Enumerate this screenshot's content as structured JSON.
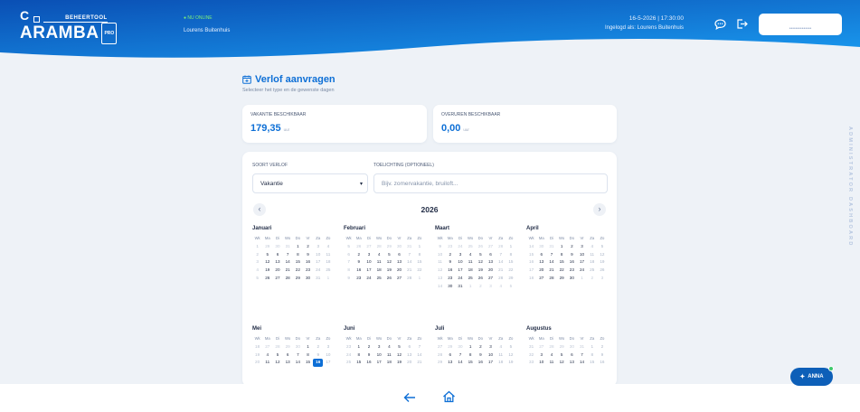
{
  "colors": {
    "brand": "#0d6fd6",
    "header_top": "#0a4fb4",
    "header_bottom": "#1a9bf0",
    "online": "#7cf07a",
    "today": "#0d6fd6"
  },
  "header": {
    "logo_top": "C",
    "logo_sub": "BEHEERTOOL",
    "logo_main": "ARAMBA",
    "logo_pro": "PRO",
    "status": "● NU ONLINE",
    "user": "Lourens Buitenhuis",
    "datetime": "16-5-2026 | 17:30:00",
    "logged_in": "Ingelogd als: Lourens Buitenhuis",
    "chat_icon": "chat-bubble-icon",
    "logout_icon": "logout-icon",
    "button_label": "••••••••••••••"
  },
  "page": {
    "title": "Verlof aanvragen",
    "subtitle": "Selecteer het type en de gewenste dagen"
  },
  "cards": [
    {
      "label": "VAKANTIE BESCHIKBAAR",
      "value": "179,35",
      "unit": "uur"
    },
    {
      "label": "OVERUREN BESCHIKBAAR",
      "value": "0,00",
      "unit": "uur"
    }
  ],
  "form": {
    "type_label": "SOORT VERLOF",
    "type_value": "Vakantie",
    "note_label": "TOELICHTING (OPTIONEEL)",
    "note_placeholder": "Bijv. zomervakantie, bruiloft..."
  },
  "calendar": {
    "year": "2026",
    "prev": "‹",
    "next": "›",
    "weekday_headers": [
      "Wk",
      "Ma",
      "Di",
      "Wo",
      "Do",
      "Vr",
      "Za",
      "Zo"
    ],
    "today": {
      "month": "Mei",
      "day": "16"
    },
    "months": [
      {
        "name": "Januari",
        "weeks": [
          {
            "wk": "1",
            "days": [
              "29",
              "30",
              "31",
              "1",
              "2",
              "3",
              "4"
            ]
          },
          {
            "wk": "2",
            "days": [
              "5",
              "6",
              "7",
              "8",
              "9",
              "10",
              "11"
            ]
          },
          {
            "wk": "3",
            "days": [
              "12",
              "13",
              "14",
              "15",
              "16",
              "17",
              "18"
            ]
          },
          {
            "wk": "4",
            "days": [
              "19",
              "20",
              "21",
              "22",
              "23",
              "24",
              "25"
            ]
          },
          {
            "wk": "5",
            "days": [
              "26",
              "27",
              "28",
              "29",
              "30",
              "31",
              "1"
            ]
          }
        ]
      },
      {
        "name": "Februari",
        "weeks": [
          {
            "wk": "5",
            "days": [
              "26",
              "27",
              "28",
              "29",
              "30",
              "31",
              "1"
            ]
          },
          {
            "wk": "6",
            "days": [
              "2",
              "3",
              "4",
              "5",
              "6",
              "7",
              "8"
            ]
          },
          {
            "wk": "7",
            "days": [
              "9",
              "10",
              "11",
              "12",
              "13",
              "14",
              "15"
            ]
          },
          {
            "wk": "8",
            "days": [
              "16",
              "17",
              "18",
              "19",
              "20",
              "21",
              "22"
            ]
          },
          {
            "wk": "9",
            "days": [
              "23",
              "24",
              "25",
              "26",
              "27",
              "28",
              "1"
            ]
          }
        ]
      },
      {
        "name": "Maart",
        "weeks": [
          {
            "wk": "9",
            "days": [
              "23",
              "24",
              "25",
              "26",
              "27",
              "28",
              "1"
            ]
          },
          {
            "wk": "10",
            "days": [
              "2",
              "3",
              "4",
              "5",
              "6",
              "7",
              "8"
            ]
          },
          {
            "wk": "11",
            "days": [
              "9",
              "10",
              "11",
              "12",
              "13",
              "14",
              "15"
            ]
          },
          {
            "wk": "12",
            "days": [
              "16",
              "17",
              "18",
              "19",
              "20",
              "21",
              "22"
            ]
          },
          {
            "wk": "13",
            "days": [
              "23",
              "24",
              "25",
              "26",
              "27",
              "28",
              "29"
            ]
          },
          {
            "wk": "14",
            "days": [
              "30",
              "31",
              "1",
              "2",
              "3",
              "4",
              "5"
            ]
          }
        ]
      },
      {
        "name": "April",
        "weeks": [
          {
            "wk": "14",
            "days": [
              "30",
              "31",
              "1",
              "2",
              "3",
              "4",
              "5"
            ]
          },
          {
            "wk": "15",
            "days": [
              "6",
              "7",
              "8",
              "9",
              "10",
              "11",
              "12"
            ]
          },
          {
            "wk": "16",
            "days": [
              "13",
              "14",
              "15",
              "16",
              "17",
              "18",
              "19"
            ]
          },
          {
            "wk": "17",
            "days": [
              "20",
              "21",
              "22",
              "23",
              "24",
              "25",
              "26"
            ]
          },
          {
            "wk": "18",
            "days": [
              "27",
              "28",
              "29",
              "30",
              "1",
              "2",
              "3"
            ]
          }
        ]
      },
      {
        "name": "Mei",
        "weeks": [
          {
            "wk": "18",
            "days": [
              "27",
              "28",
              "29",
              "30",
              "1",
              "2",
              "3"
            ]
          },
          {
            "wk": "19",
            "days": [
              "4",
              "5",
              "6",
              "7",
              "8",
              "9",
              "10"
            ]
          },
          {
            "wk": "20",
            "days": [
              "11",
              "12",
              "13",
              "14",
              "15",
              "16",
              "17"
            ]
          }
        ]
      },
      {
        "name": "Juni",
        "weeks": [
          {
            "wk": "23",
            "days": [
              "1",
              "2",
              "3",
              "4",
              "5",
              "6",
              "7"
            ]
          },
          {
            "wk": "24",
            "days": [
              "8",
              "9",
              "10",
              "11",
              "12",
              "13",
              "14"
            ]
          },
          {
            "wk": "25",
            "days": [
              "15",
              "16",
              "17",
              "18",
              "19",
              "20",
              "21"
            ]
          }
        ]
      },
      {
        "name": "Juli",
        "weeks": [
          {
            "wk": "27",
            "days": [
              "29",
              "30",
              "1",
              "2",
              "3",
              "4",
              "5"
            ]
          },
          {
            "wk": "28",
            "days": [
              "6",
              "7",
              "8",
              "9",
              "10",
              "11",
              "12"
            ]
          },
          {
            "wk": "29",
            "days": [
              "13",
              "14",
              "15",
              "16",
              "17",
              "18",
              "19"
            ]
          }
        ]
      },
      {
        "name": "Augustus",
        "weeks": [
          {
            "wk": "31",
            "days": [
              "27",
              "28",
              "29",
              "30",
              "31",
              "1",
              "2"
            ]
          },
          {
            "wk": "32",
            "days": [
              "3",
              "4",
              "5",
              "6",
              "7",
              "8",
              "9"
            ]
          },
          {
            "wk": "33",
            "days": [
              "10",
              "11",
              "12",
              "13",
              "14",
              "15",
              "16"
            ]
          }
        ]
      }
    ]
  },
  "sidebar_label": "ADMINISTRATOR DASHBOARD",
  "assistant": {
    "label": "ANNA",
    "icon": "sparkle-icon"
  },
  "footer": {
    "back_icon": "arrow-left-icon",
    "home_icon": "home-icon"
  }
}
